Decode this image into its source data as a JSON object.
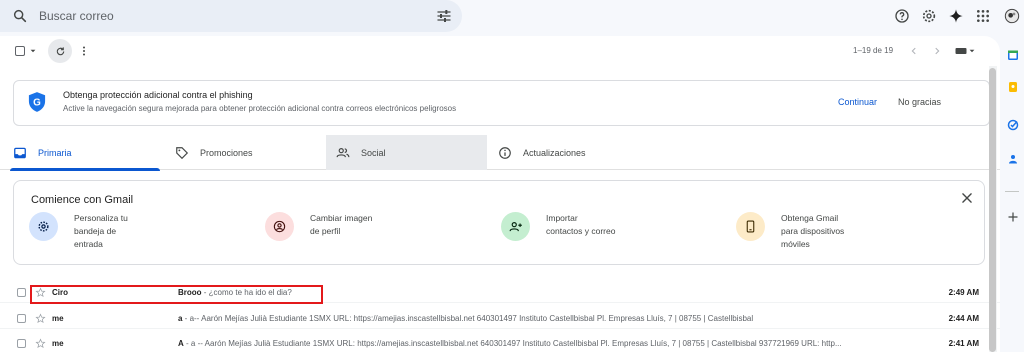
{
  "search": {
    "placeholder": "Buscar correo"
  },
  "toolbar": {
    "pager": "1–19 de 19"
  },
  "banner": {
    "title": "Obtenga protección adicional contra el phishing",
    "subtitle": "Active la navegación segura mejorada para obtener protección adicional contra correos electrónicos peligrosos",
    "continue": "Continuar",
    "dismiss": "No gracias"
  },
  "tabs": [
    {
      "label": "Primaria",
      "icon": "inbox-icon"
    },
    {
      "label": "Promociones",
      "icon": "tag-icon"
    },
    {
      "label": "Social",
      "icon": "people-icon"
    },
    {
      "label": "Actualizaciones",
      "icon": "info-icon"
    }
  ],
  "card": {
    "title": "Comience con Gmail",
    "features": [
      {
        "label": "Personaliza tu\nbandeja de\nentrada",
        "icon": "gear-icon",
        "color": "#d3e3fd"
      },
      {
        "label": "Cambiar imagen\nde perfil",
        "icon": "profile-icon",
        "color": "#fcdede"
      },
      {
        "label": "Importar\ncontactos y correo",
        "icon": "add-contact-icon",
        "color": "#c4eed0"
      },
      {
        "label": "Obtenga Gmail\npara dispositivos\nmóviles",
        "icon": "phone-icon",
        "color": "#fdebc8"
      }
    ]
  },
  "emails": [
    {
      "sender": "Ciro",
      "subject": "Brooo",
      "snippet": " - ¿como te ha ido el dia?",
      "time": "2:49 AM"
    },
    {
      "sender": "me",
      "subject": "a",
      "snippet": " - a-- Aarón Mejías Julià Estudiante 1SMX URL: https://amejias.inscastellbisbal.net 640301497 Instituto Castellbisbal Pl. Empresas Lluís, 7 | 08755 | Castellbisbal",
      "time": "2:44 AM"
    },
    {
      "sender": "me",
      "subject": "A",
      "snippet": " - a -- Aarón Mejías Julià Estudiante 1SMX URL: https://amejias.inscastellbisbal.net 640301497 Instituto Castellbisbal Pl. Empresas Lluís, 7 | 08755 | Castellbisbal 937721969 URL: http...",
      "time": "2:41 AM"
    }
  ],
  "colors": {
    "accent": "#0b57d0",
    "highlight": "#e3191b"
  }
}
